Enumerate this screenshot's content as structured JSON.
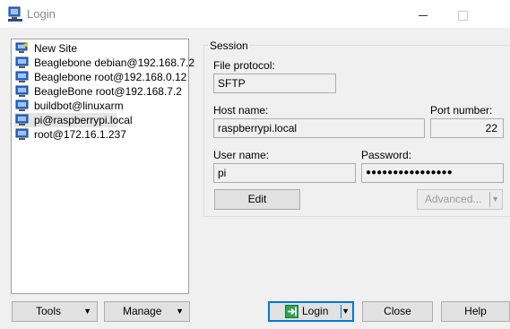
{
  "window": {
    "title": "Login"
  },
  "sites": [
    {
      "name": "New Site",
      "icon": "new-site-icon"
    },
    {
      "name": "Beaglebone debian@192.168.7.2",
      "icon": "computer-icon"
    },
    {
      "name": "Beaglebone root@192.168.0.12",
      "icon": "computer-icon"
    },
    {
      "name": "BeagleBone root@192.168.7.2",
      "icon": "computer-icon"
    },
    {
      "name": "buildbot@linuxarm",
      "icon": "computer-icon"
    },
    {
      "name": "pi@raspberrypi.local",
      "icon": "computer-icon",
      "selected": true
    },
    {
      "name": "root@172.16.1.237",
      "icon": "computer-icon"
    }
  ],
  "session": {
    "group_title": "Session",
    "file_protocol_label": "File protocol:",
    "file_protocol_value": "SFTP",
    "host_name_label": "Host name:",
    "host_name_value": "raspberrypi.local",
    "port_label": "Port number:",
    "port_value": "22",
    "user_name_label": "User name:",
    "user_name_value": "pi",
    "password_label": "Password:",
    "password_value": "●●●●●●●●●●●●●●●●",
    "edit_label": "Edit",
    "advanced_label": "Advanced..."
  },
  "buttons": {
    "tools": "Tools",
    "manage": "Manage",
    "login": "Login",
    "close": "Close",
    "help": "Help"
  },
  "colors": {
    "accent": "#0078d7",
    "login_icon": "#2da44e"
  }
}
